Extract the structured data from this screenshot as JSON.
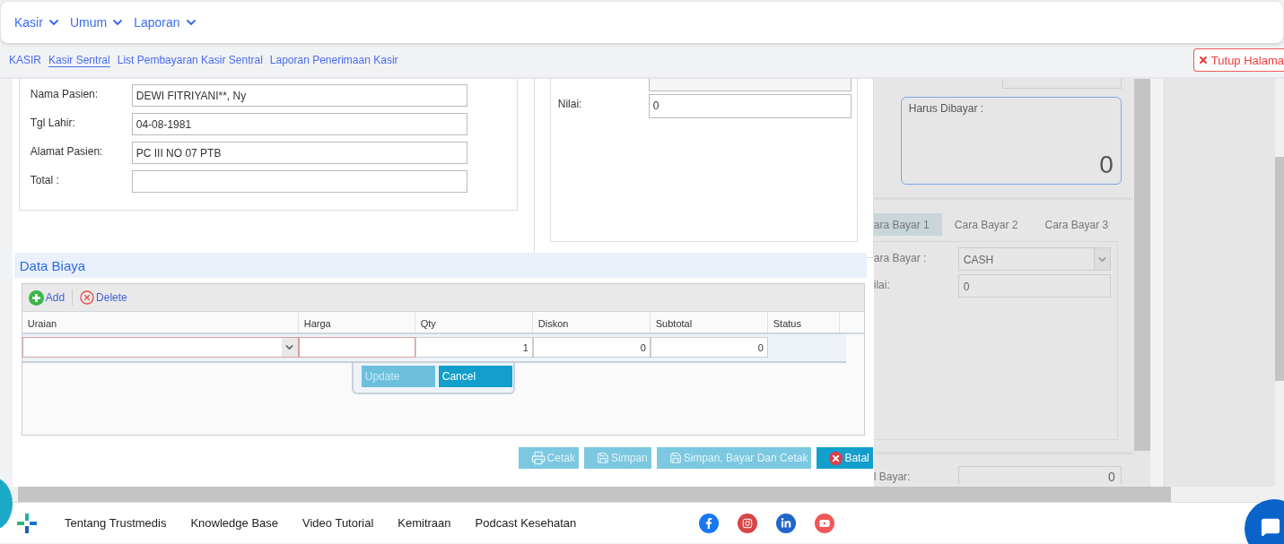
{
  "nav_menu": [
    {
      "label": "Kasir"
    },
    {
      "label": "Umum"
    },
    {
      "label": "Laporan"
    }
  ],
  "breadcrumbs": [
    {
      "label": "KASIR",
      "selected": false
    },
    {
      "label": "Kasir Sentral",
      "selected": true
    },
    {
      "label": "List Pembayaran Kasir Sentral",
      "selected": false
    },
    {
      "label": "Laporan Penerimaan Kasir",
      "selected": false
    }
  ],
  "close_button": {
    "label": "Tutup Halama"
  },
  "patient_form": {
    "fields": [
      {
        "label": "Nama Pasien:",
        "value": "DEWI FITRIYANI**, Ny"
      },
      {
        "label": "Tgl Lahir:",
        "value": "04-08-1981"
      },
      {
        "label": "Alamat Pasien:",
        "value": "PC III NO 07 PTB"
      },
      {
        "label": "Total :"
      }
    ]
  },
  "payment_form": {
    "fields": [
      {
        "label": "Nilai:",
        "value": "0"
      }
    ]
  },
  "data_biaya": {
    "title": "Data Biaya",
    "toolbar": [
      {
        "label": "Add",
        "kind": "add"
      },
      {
        "label": "Delete",
        "kind": "delete"
      }
    ],
    "columns": [
      "Uraian",
      "Harga",
      "Qty",
      "Diskon",
      "Subtotal",
      "Status"
    ],
    "edit_row": {
      "qty": "1",
      "diskon": "0",
      "subtotal": "0"
    },
    "row_actions": [
      {
        "label": "Update",
        "disabled": true
      },
      {
        "label": "Cancel",
        "disabled": false
      }
    ]
  },
  "actions": [
    {
      "label": "Cetak",
      "kind": "print",
      "disabled": true
    },
    {
      "label": "Simpan",
      "kind": "save",
      "disabled": true
    },
    {
      "label": "Simpan, Bayar Dan Cetak",
      "kind": "save",
      "disabled": true
    },
    {
      "label": "Batal",
      "kind": "cancel",
      "disabled": false
    }
  ],
  "summary_panel": {
    "amount_due": {
      "label": "Harus Dibayar :",
      "value": "0"
    },
    "tabs": [
      {
        "label": "ara Bayar 1",
        "selected": true
      },
      {
        "label": "Cara Bayar 2",
        "selected": false
      },
      {
        "label": "Cara Bayar 3",
        "selected": false
      }
    ],
    "fields": [
      {
        "label": "ara Bayar :",
        "value": "CASH",
        "kind": "select"
      },
      {
        "label": "ilai:",
        "value": "0",
        "kind": "text"
      }
    ],
    "paid": {
      "label": "l Bayar:",
      "value": "0"
    }
  },
  "footer": {
    "links": [
      "Tentang Trustmedis",
      "Knowledge Base",
      "Video Tutorial",
      "Kemitraan",
      "Podcast Kesehatan"
    ],
    "social": [
      {
        "kind": "facebook"
      },
      {
        "kind": "instagram"
      },
      {
        "kind": "linkedin"
      },
      {
        "kind": "youtube"
      }
    ]
  }
}
